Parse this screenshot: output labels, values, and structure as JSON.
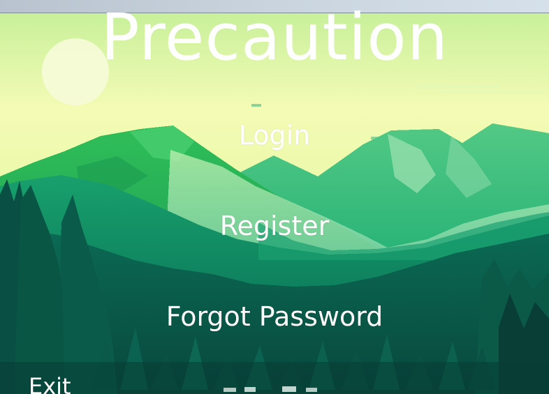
{
  "window": {
    "title_bar_color": "#c9d4de"
  },
  "scene": {
    "background": "pixel-art-mountain-forest",
    "sky_colors": [
      "#f6fbb8",
      "#d9f39d",
      "#a8e59b"
    ],
    "mountain_colors": [
      "#28b85a",
      "#66c98b",
      "#8edbb0",
      "#159a68",
      "#0f7a58",
      "#0b5e4b"
    ],
    "forest_colors": [
      "#0d4f43",
      "#0a3f38"
    ]
  },
  "menu": {
    "title": "Precaution",
    "login_label": "Login",
    "register_label": "Register",
    "forgot_password_label": "Forgot Password",
    "exit_label": "Exit"
  }
}
